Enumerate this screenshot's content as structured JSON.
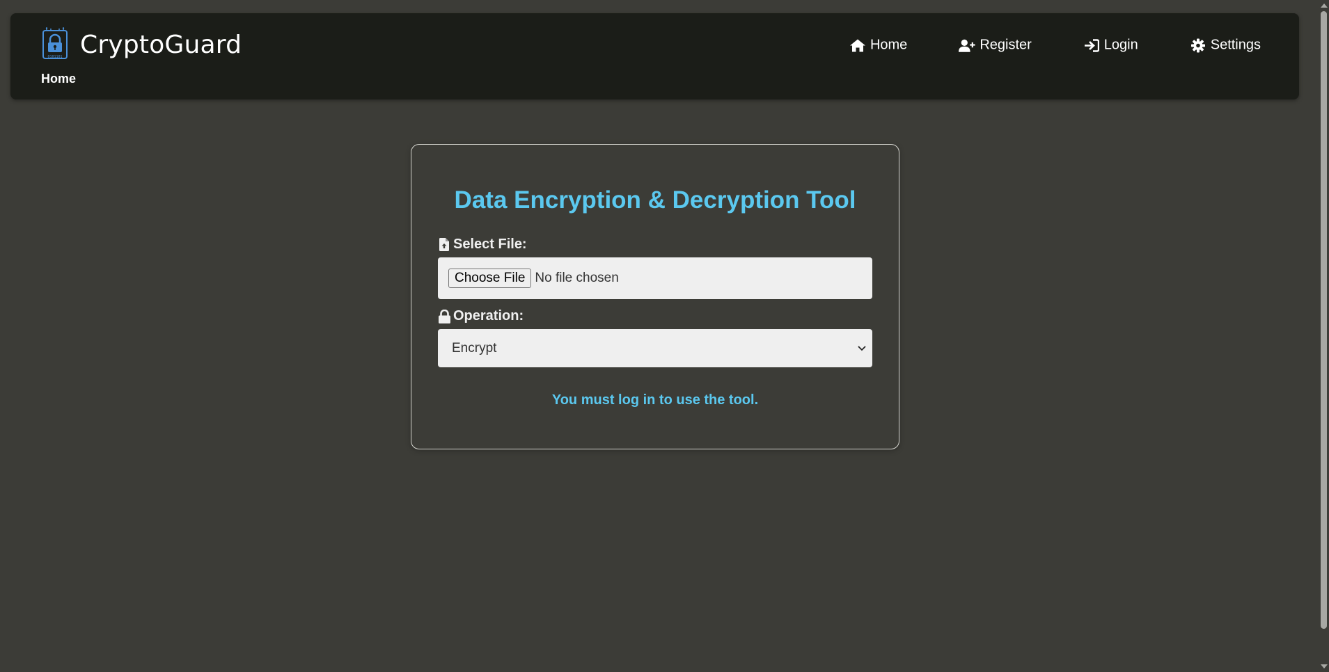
{
  "header": {
    "brand_name": "CryptoGuard",
    "breadcrumb": "Home",
    "nav": [
      {
        "label": "Home",
        "icon": "home-icon"
      },
      {
        "label": "Register",
        "icon": "user-plus-icon"
      },
      {
        "label": "Login",
        "icon": "sign-in-icon"
      },
      {
        "label": "Settings",
        "icon": "gear-icon"
      }
    ]
  },
  "tool": {
    "title": "Data Encryption & Decryption Tool",
    "file_label": "Select File:",
    "file_button": "Choose File",
    "file_status": "No file chosen",
    "operation_label": "Operation:",
    "operation_value": "Encrypt",
    "notice": "You must log in to use the tool."
  },
  "colors": {
    "background": "#3c3c37",
    "header_bg": "#1b1d18",
    "accent": "#5bc8ef"
  }
}
